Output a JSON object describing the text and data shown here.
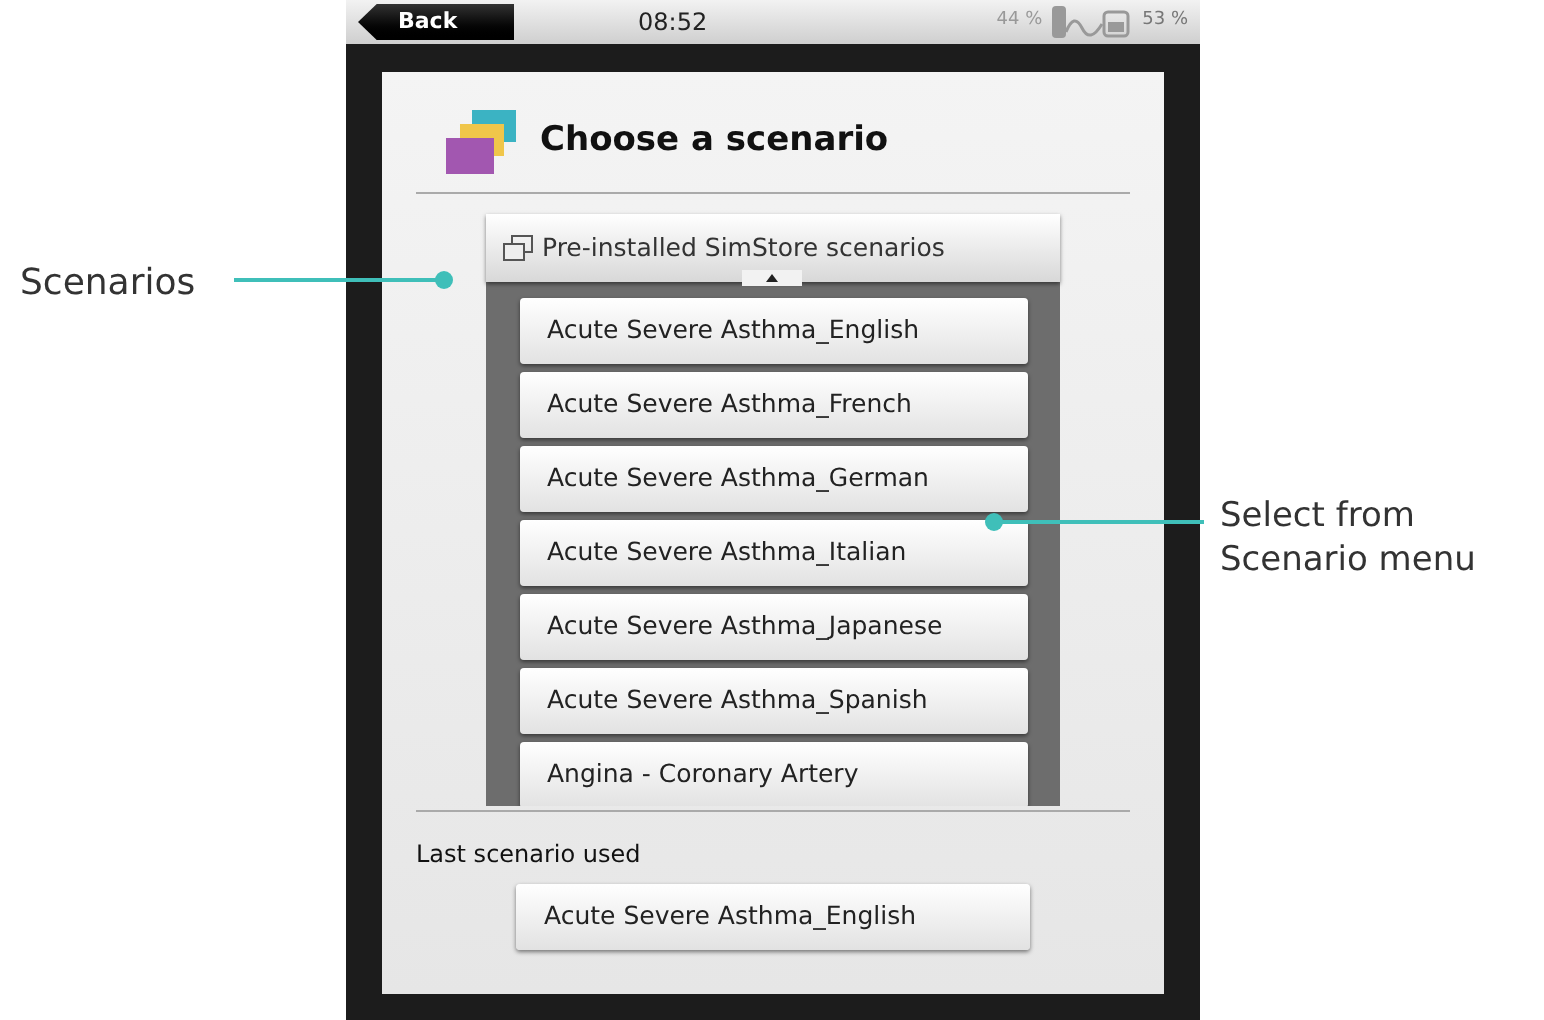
{
  "status_bar": {
    "back": "Back",
    "time": "08:52",
    "left_level_text": "44 %",
    "right_level_text": "53 %"
  },
  "title": "Choose a scenario",
  "dropdown": {
    "label": "Pre-installed SimStore scenarios",
    "expanded": true
  },
  "scenarios": [
    {
      "label": "Acute Severe Asthma_English"
    },
    {
      "label": "Acute Severe Asthma_French"
    },
    {
      "label": "Acute Severe Asthma_German"
    },
    {
      "label": "Acute Severe Asthma_Italian"
    },
    {
      "label": "Acute Severe Asthma_Japanese"
    },
    {
      "label": "Acute Severe Asthma_Spanish"
    },
    {
      "label": "Angina - Coronary Artery"
    }
  ],
  "last_used": {
    "label": "Last scenario used",
    "value": "Acute Severe Asthma_English"
  },
  "callouts": [
    {
      "text": "Scenarios"
    },
    {
      "text": "Select from Scenario menu"
    }
  ]
}
